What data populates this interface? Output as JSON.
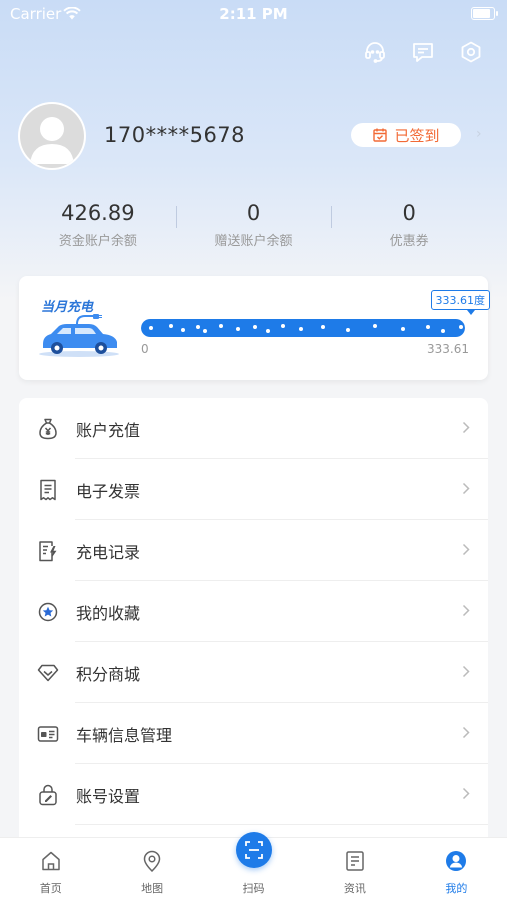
{
  "status_bar": {
    "carrier": "Carrier",
    "time": "2:11 PM",
    "battery_level": 1.0
  },
  "header": {
    "icons": [
      "headset-icon",
      "message-icon",
      "settings-icon"
    ]
  },
  "profile": {
    "phone": "170****5678",
    "checkin_label": "已签到"
  },
  "stats": [
    {
      "value": "426.89",
      "label": "资金账户余额"
    },
    {
      "value": "0",
      "label": "赠送账户余额"
    },
    {
      "value": "0",
      "label": "优惠券"
    }
  ],
  "monthly_charge": {
    "title": "当月充电",
    "value_tag": "333.61度",
    "min_label": "0",
    "max_label": "333.61",
    "progress": 1.0
  },
  "menu": [
    {
      "label": "账户充值",
      "icon": "money-bag-icon"
    },
    {
      "label": "电子发票",
      "icon": "receipt-icon"
    },
    {
      "label": "充电记录",
      "icon": "charge-record-icon"
    },
    {
      "label": "我的收藏",
      "icon": "star-icon"
    },
    {
      "label": "积分商城",
      "icon": "diamond-icon"
    },
    {
      "label": "车辆信息管理",
      "icon": "vehicle-card-icon"
    },
    {
      "label": "账号设置",
      "icon": "account-settings-icon"
    }
  ],
  "tabbar": [
    {
      "label": "首页",
      "icon": "home-icon"
    },
    {
      "label": "地图",
      "icon": "map-pin-icon"
    },
    {
      "label": "扫码",
      "icon": "scan-icon"
    },
    {
      "label": "资讯",
      "icon": "news-icon"
    },
    {
      "label": "我的",
      "icon": "profile-icon",
      "active": true
    }
  ],
  "colors": {
    "accent": "#1e7be8",
    "checkin": "#f26a36",
    "icon": "#555555"
  }
}
